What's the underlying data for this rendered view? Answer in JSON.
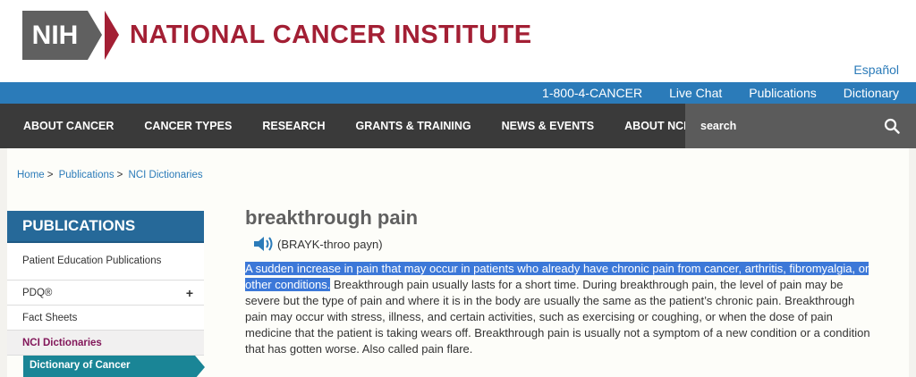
{
  "header": {
    "logo_abbr": "NIH",
    "institute_name": "NATIONAL CANCER INSTITUTE",
    "language_link": "Español"
  },
  "utility_bar": {
    "phone": "1-800-4-CANCER",
    "live_chat": "Live Chat",
    "publications": "Publications",
    "dictionary": "Dictionary"
  },
  "nav": {
    "items": [
      "ABOUT CANCER",
      "CANCER TYPES",
      "RESEARCH",
      "GRANTS & TRAINING",
      "NEWS & EVENTS",
      "ABOUT NCI"
    ],
    "search_placeholder": "search"
  },
  "breadcrumb": {
    "home": "Home",
    "publications": "Publications",
    "dictionaries": "NCI Dictionaries",
    "separator": ">"
  },
  "sidebar": {
    "title": "PUBLICATIONS",
    "items": [
      {
        "label": "Patient Education Publications"
      },
      {
        "label": "PDQ®",
        "expander": "+"
      },
      {
        "label": "Fact Sheets"
      },
      {
        "label": "NCI Dictionaries"
      }
    ],
    "sub_item": "Dictionary of Cancer"
  },
  "term": {
    "title": "breakthrough pain",
    "pronunciation": "(BRAYK-throo payn)",
    "definition_highlighted": "A sudden increase in pain that may occur in patients who already have chronic pain from cancer, arthritis, fibromyalgia, or other conditions.",
    "definition_rest": " Breakthrough pain usually lasts for a short time. During breakthrough pain, the level of pain may be severe but the type of pain and where it is in the body are usually the same as the patient’s chronic pain. Breakthrough pain may occur with stress, illness, and certain activities, such as exercising or coughing, or when the dose of pain medicine that the patient is taking wears off. Breakthrough pain is usually not a symptom of a new condition or a condition that has gotten worse. Also called pain flare."
  },
  "colors": {
    "brand_red": "#a31f34",
    "utility_blue": "#2b7bb9",
    "nav_dark": "#3a3a3a",
    "sidebar_blue": "#266999",
    "teal": "#1a8596",
    "highlight": "#3c78d8"
  }
}
